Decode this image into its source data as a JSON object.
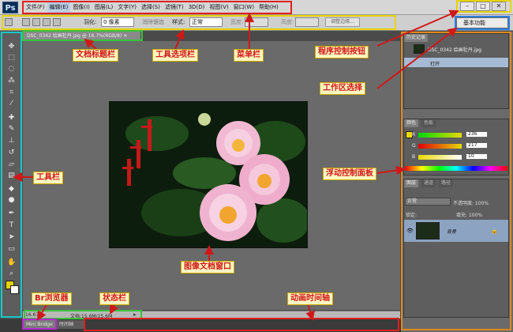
{
  "app": {
    "logo": "Ps",
    "menus": [
      "文件(F)",
      "编辑(E)",
      "图像(I)",
      "图层(L)",
      "文字(Y)",
      "选择(S)",
      "滤镜(T)",
      "3D(D)",
      "视图(V)",
      "窗口(W)",
      "帮助(H)"
    ],
    "active_menu": "编辑(E)",
    "window_controls": [
      "–",
      "□",
      "✕"
    ],
    "workspace": "基本功能"
  },
  "options_bar": {
    "feather_label": "羽化:",
    "feather_value": "0 像素",
    "antialias": "消除锯齿",
    "style_label": "样式:",
    "style_value": "正常",
    "width_label": "宽度:",
    "height_label": "高度:",
    "refine_button": "调整边缘..."
  },
  "document": {
    "tab": "DSC_0342 绘画牡丹.jpg @ 16.7%(RGB/8) ✕"
  },
  "status": {
    "zoom": "16.67%",
    "doc_size": "文档:15.6M/15.6M"
  },
  "bottom": {
    "mini_bridge": "Mini Bridge",
    "timeline": "时间轴"
  },
  "panels": {
    "history_title": "历史记录",
    "history_doc": "DSC_0342 绘画牡丹.jpg",
    "history_open": "打开",
    "color_tab": "颜色",
    "swatch_tab": "色板",
    "color_r_label": "R",
    "color_r": "236",
    "color_g_label": "G",
    "color_g": "217",
    "color_b_label": "B",
    "color_b": "10",
    "layers_tab": "图层",
    "channels_tab": "通道",
    "paths_tab": "路径",
    "blend_mode": "正常",
    "opacity_label": "不透明度: 100%",
    "lock_label": "锁定:",
    "fill_label": "填充: 100%",
    "layer_name": "背景"
  },
  "callouts": {
    "doc_title_bar": "文档标题栏",
    "tool_options_bar": "工具选项栏",
    "menu_bar": "菜单栏",
    "window_control_buttons": "程序控制按钮",
    "workspace_select": "工作区选择",
    "floating_panels": "浮动控制面板",
    "toolbar": "工具栏",
    "doc_window": "图像文档窗口",
    "br_browser": "Br浏览器",
    "status_bar": "状态栏",
    "timeline": "动画时间轴"
  },
  "colors": {
    "menu_box": "#e02020",
    "options_box": "#e7d300",
    "doc_tab_box": "#37c23a",
    "toolbar_box": "#18c9c9",
    "workspace_box": "#2e7ee0",
    "dock_box": "#e08a1c",
    "bridge_box": "#b52ccf",
    "arrow": "#d01818"
  },
  "icons": [
    "move-tool-icon",
    "marquee-tool-icon",
    "lasso-tool-icon",
    "quick-select-tool-icon",
    "crop-tool-icon",
    "eyedropper-tool-icon",
    "healing-brush-icon",
    "brush-tool-icon",
    "clone-stamp-icon",
    "history-brush-icon",
    "eraser-tool-icon",
    "gradient-tool-icon",
    "blur-tool-icon",
    "dodge-tool-icon",
    "pen-tool-icon",
    "type-tool-icon",
    "path-select-icon",
    "shape-tool-icon",
    "hand-tool-icon",
    "zoom-tool-icon"
  ]
}
